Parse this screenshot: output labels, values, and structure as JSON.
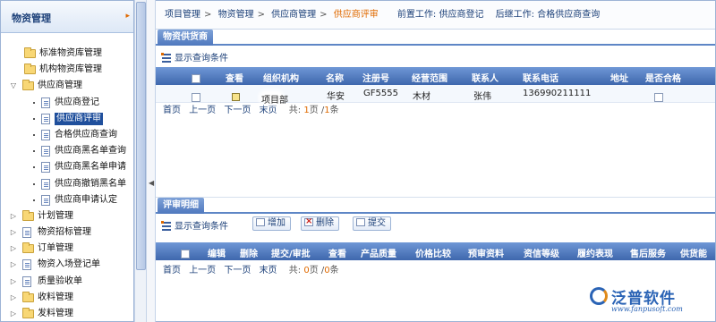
{
  "sidebar": {
    "title": "物资管理",
    "items": [
      {
        "label": "标准物资库管理",
        "type": "folder",
        "level": 0,
        "expander": ""
      },
      {
        "label": "机构物资库管理",
        "type": "folder",
        "level": 0,
        "expander": ""
      },
      {
        "label": "供应商管理",
        "type": "folder",
        "level": 0,
        "expander": "▽"
      },
      {
        "label": "供应商登记",
        "type": "doc",
        "level": 1,
        "expander": ""
      },
      {
        "label": "供应商评审",
        "type": "doc",
        "level": 1,
        "expander": "",
        "selected": true
      },
      {
        "label": "合格供应商查询",
        "type": "doc",
        "level": 1,
        "expander": ""
      },
      {
        "label": "供应商黑名单查询",
        "type": "doc",
        "level": 1,
        "expander": ""
      },
      {
        "label": "供应商黑名单申请",
        "type": "doc",
        "level": 1,
        "expander": ""
      },
      {
        "label": "供应商撤销黑名单",
        "type": "doc",
        "level": 1,
        "expander": ""
      },
      {
        "label": "供应商申请认定",
        "type": "doc",
        "level": 1,
        "expander": ""
      },
      {
        "label": "计划管理",
        "type": "folder",
        "level": 0,
        "expander": "▷"
      },
      {
        "label": "物资招标管理",
        "type": "doc",
        "level": 0,
        "expander": "▷"
      },
      {
        "label": "订单管理",
        "type": "folder",
        "level": 0,
        "expander": "▷"
      },
      {
        "label": "物资入场登记单",
        "type": "doc",
        "level": 0,
        "expander": "▷"
      },
      {
        "label": "质量验收单",
        "type": "doc",
        "level": 0,
        "expander": "▷"
      },
      {
        "label": "收料管理",
        "type": "folder",
        "level": 0,
        "expander": "▷"
      },
      {
        "label": "发料管理",
        "type": "folder",
        "level": 0,
        "expander": "▷"
      }
    ]
  },
  "breadcrumb": {
    "items": [
      "项目管理",
      "物资管理",
      "供应商管理",
      "供应商评审"
    ],
    "separator": ">",
    "prev_work": "前置工作: 供应商登记",
    "next_work": "后继工作: 合格供应商查询"
  },
  "suppliers": {
    "tab": "物资供货商",
    "query_label": "显示查询条件",
    "columns": [
      "查看",
      "组织机构",
      "名称",
      "注册号",
      "经营范围",
      "联系人",
      "联系电话",
      "地址",
      "是否合格"
    ],
    "rows": [
      {
        "org": "项目部",
        "name": "华安",
        "reg_no": "GF5555",
        "scope": "木材",
        "contact": "张伟",
        "phone": "136990211111",
        "address": ""
      }
    ],
    "pager": {
      "first": "首页",
      "prev": "上一页",
      "next": "下一页",
      "last": "末页",
      "total_prefix": "共:",
      "page": "1",
      "page_sep": "页 /",
      "count": "1",
      "count_suffix": "条"
    }
  },
  "review": {
    "tab": "评审明细",
    "query_label": "显示查询条件",
    "buttons": {
      "add": "增加",
      "delete": "删除",
      "submit": "提交"
    },
    "columns": [
      "编辑",
      "删除",
      "提交/审批",
      "查看",
      "产品质量",
      "价格比较",
      "预审资料",
      "资信等级",
      "履约表现",
      "售后服务",
      "供货能"
    ],
    "pager": {
      "first": "首页",
      "prev": "上一页",
      "next": "下一页",
      "last": "末页",
      "total_prefix": "共:",
      "page": "0",
      "page_sep": "页 /",
      "count": "0",
      "count_suffix": "条"
    }
  },
  "watermark": {
    "brand": "泛普软件",
    "url": "www.fanpusoft.com"
  },
  "colors": {
    "accent": "#e06a00",
    "header_blue": "#4f78be",
    "text_blue": "#1b3f78"
  }
}
